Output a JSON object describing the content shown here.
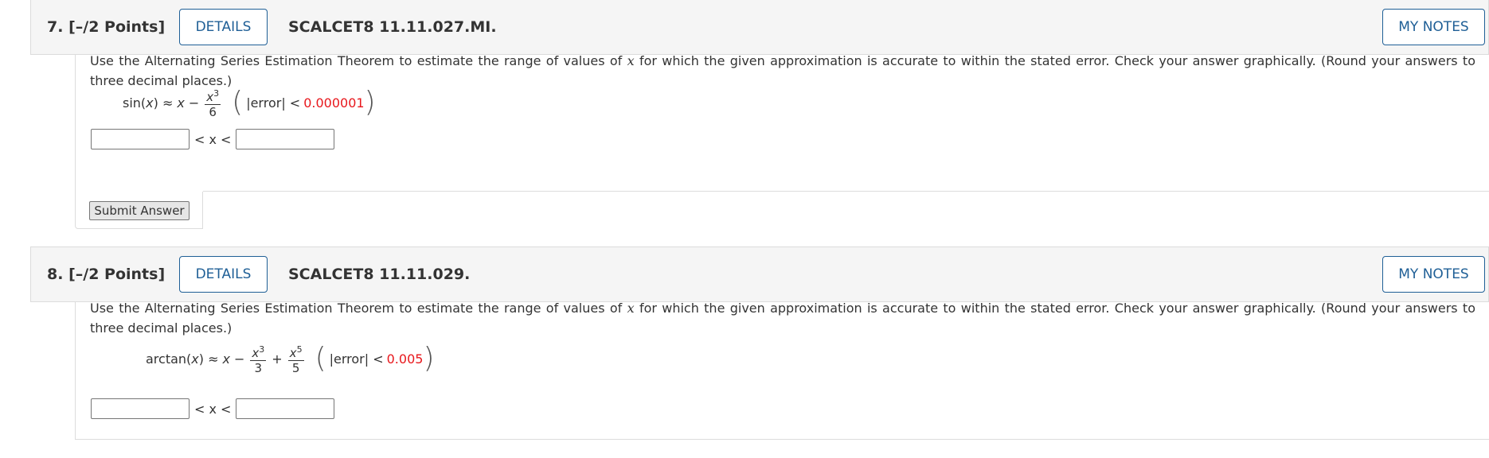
{
  "questions": [
    {
      "number": "7.",
      "points": "[–/2 Points]",
      "details_label": "DETAILS",
      "id": "SCALCET8 11.11.027.MI.",
      "notes_label": "MY NOTES",
      "prompt_a": "Use the Alternating Series Estimation Theorem to estimate the range of values of ",
      "prompt_var": "x",
      "prompt_b": " for which the given approximation is accurate to within the stated error. Check your answer graphically. (Round your answers to three decimal places.)",
      "formula": {
        "lhs": "sin(",
        "lhs_var": "x",
        "lhs_close": ") ≈",
        "x": "x",
        "terms": [
          {
            "sign": "−",
            "num": "x",
            "exp": "3",
            "den": "6"
          }
        ],
        "error_label": "|error| <",
        "error_value": "0.000001"
      },
      "ineq": "< x <",
      "lower_value": "",
      "upper_value": "",
      "submit_label": "Submit Answer"
    },
    {
      "number": "8.",
      "points": "[–/2 Points]",
      "details_label": "DETAILS",
      "id": "SCALCET8 11.11.029.",
      "notes_label": "MY NOTES",
      "prompt_a": "Use the Alternating Series Estimation Theorem to estimate the range of values of ",
      "prompt_var": "x",
      "prompt_b": " for which the given approximation is accurate to within the stated error. Check your answer graphically. (Round your answers to three decimal places.)",
      "formula": {
        "lhs": "arctan(",
        "lhs_var": "x",
        "lhs_close": ") ≈",
        "x": "x",
        "terms": [
          {
            "sign": "−",
            "num": "x",
            "exp": "3",
            "den": "3"
          },
          {
            "sign": "+",
            "num": "x",
            "exp": "5",
            "den": "5"
          }
        ],
        "error_label": "|error| <",
        "error_value": "0.005"
      },
      "ineq": "< x <",
      "lower_value": "",
      "upper_value": ""
    }
  ],
  "colors": {
    "accent": "#1f5f96",
    "error_value": "#e8171c",
    "header_bg": "#f5f5f5"
  }
}
